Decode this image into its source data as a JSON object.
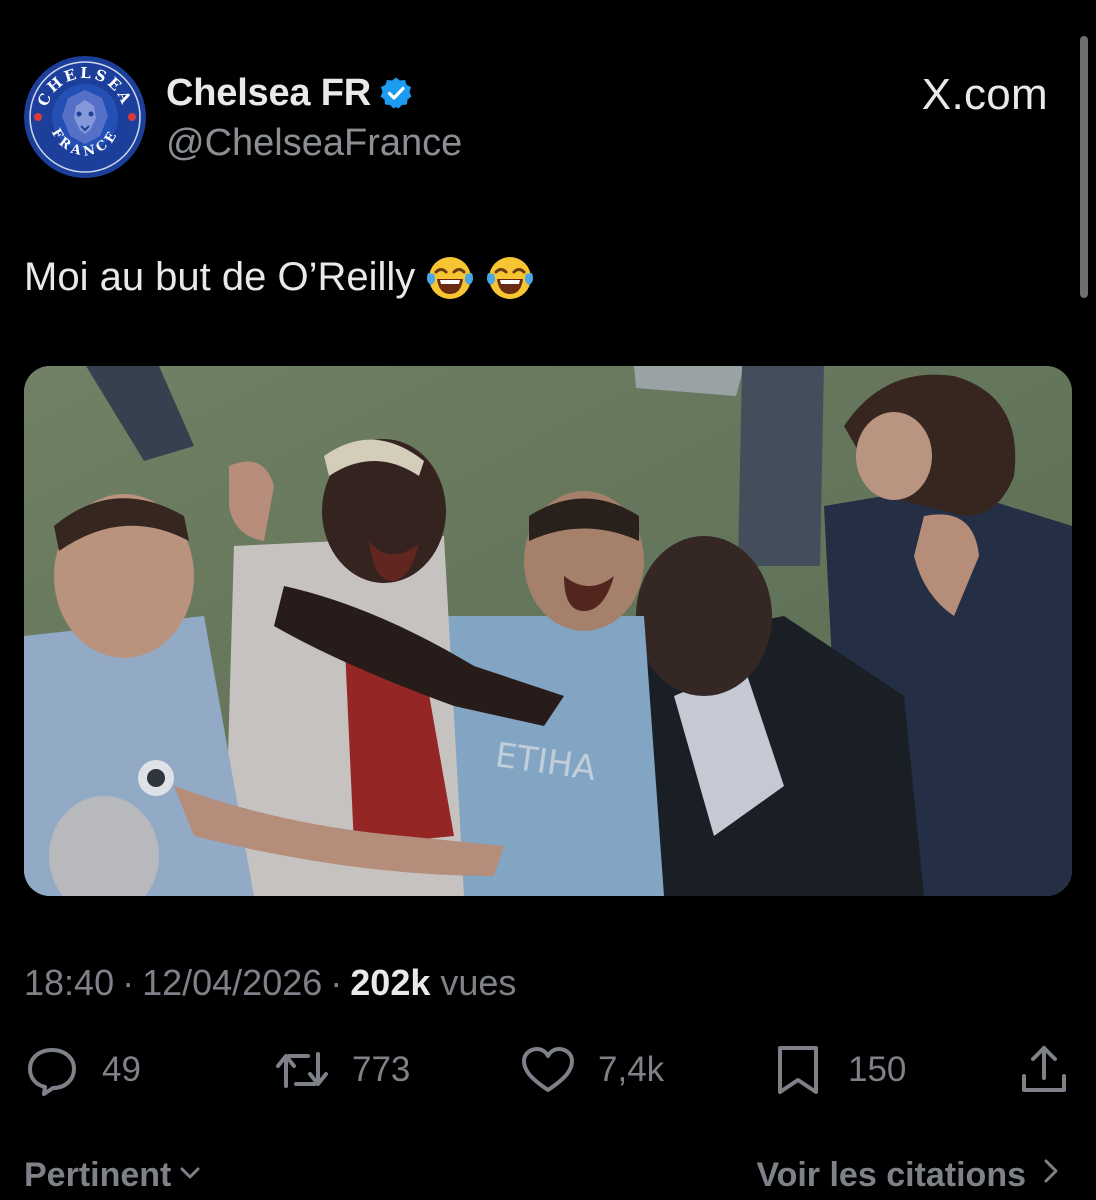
{
  "account": {
    "display_name": "Chelsea FR",
    "handle": "@ChelseaFrance",
    "verified": true,
    "avatar_icon": "chelsea-france-crest",
    "avatar_text_top": "CHELSEA",
    "avatar_text_bottom": "FRANCE"
  },
  "brand": {
    "label": "X.com"
  },
  "tweet": {
    "text": "Moi au but de O’Reilly",
    "emojis": [
      "face-with-tears-of-joy",
      "face-with-tears-of-joy"
    ],
    "media_type": "video-still"
  },
  "meta": {
    "time": "18:40",
    "separator": "·",
    "date": "12/04/2026",
    "views_count": "202k",
    "views_label": "vues"
  },
  "actions": {
    "replies": {
      "icon": "reply-icon",
      "count": "49"
    },
    "reposts": {
      "icon": "repost-icon",
      "count": "773"
    },
    "likes": {
      "icon": "heart-icon",
      "count": "7,4k"
    },
    "bookmarks": {
      "icon": "bookmark-icon",
      "count": "150"
    },
    "share": {
      "icon": "share-icon"
    }
  },
  "footer": {
    "sort_label": "Pertinent",
    "quotes_label": "Voir les citations"
  },
  "colors": {
    "background": "#000000",
    "text_primary": "#e7e9ea",
    "text_secondary": "#7e8288",
    "verified_blue": "#1d9bf0"
  }
}
